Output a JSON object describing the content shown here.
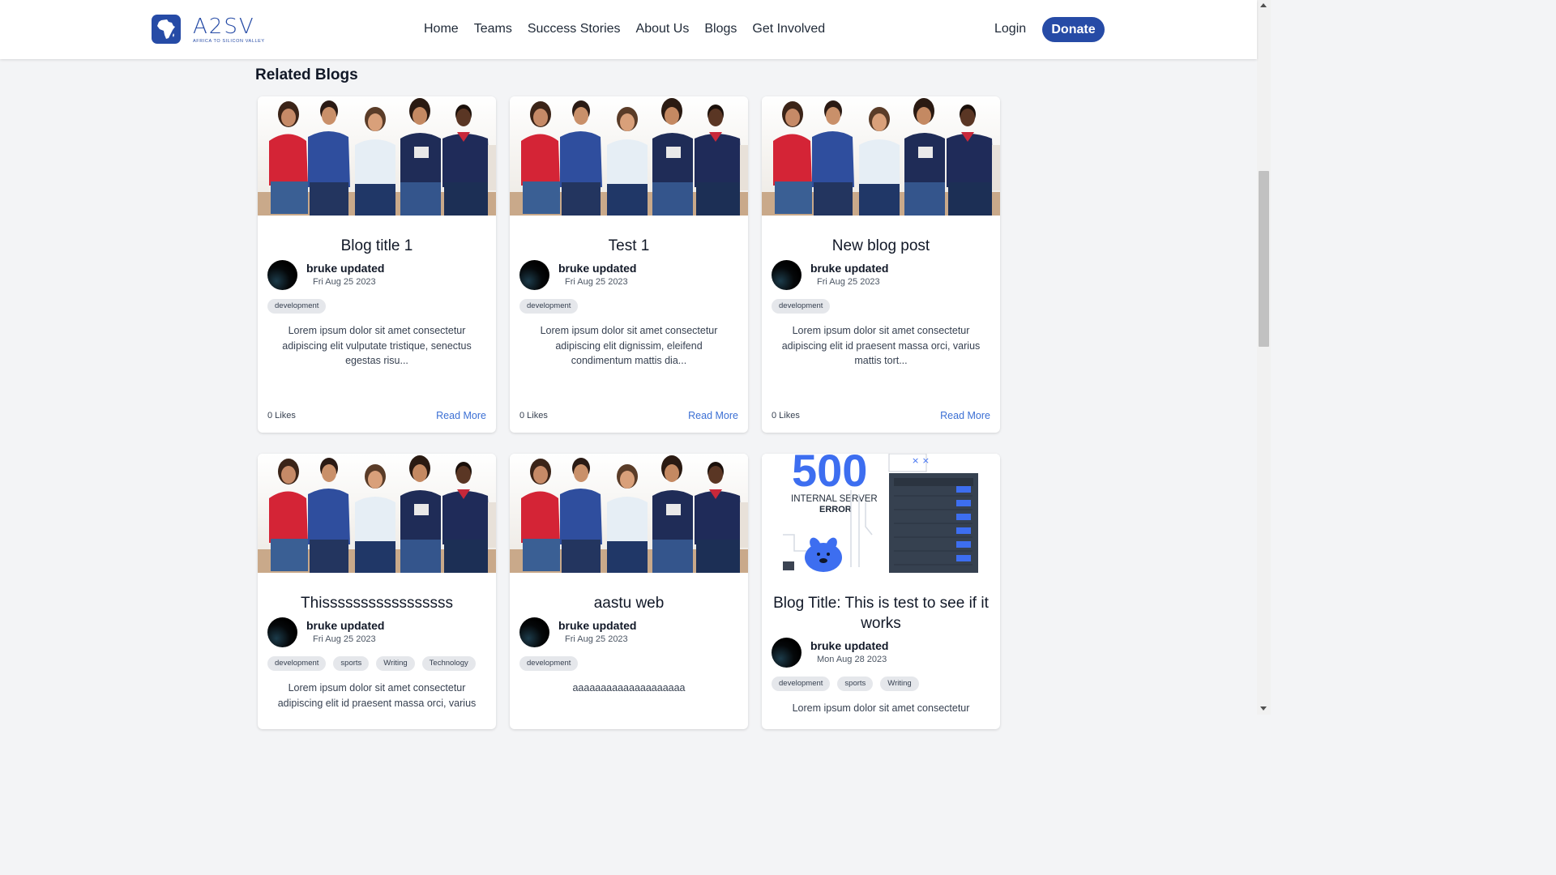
{
  "header": {
    "logo_text": "A2SV",
    "logo_subtitle": "AFRICA TO SILICON VALLEY",
    "nav": [
      "Home",
      "Teams",
      "Success Stories",
      "About Us",
      "Blogs",
      "Get Involved"
    ],
    "login": "Login",
    "donate": "Donate"
  },
  "section_title": "Related Blogs",
  "cards": [
    {
      "title": "Blog title 1",
      "author": "bruke updated",
      "date": "Fri Aug 25 2023",
      "tags": [
        "development"
      ],
      "excerpt": "Lorem ipsum dolor sit amet consectetur adipiscing elit vulputate tristique, senectus egestas risu...",
      "likes": "0 Likes",
      "read_more": "Read More",
      "image": "group-photo"
    },
    {
      "title": "Test 1",
      "author": "bruke updated",
      "date": "Fri Aug 25 2023",
      "tags": [
        "development"
      ],
      "excerpt": "Lorem ipsum dolor sit amet consectetur adipiscing elit dignissim, eleifend condimentum mattis dia...",
      "likes": "0 Likes",
      "read_more": "Read More",
      "image": "group-photo"
    },
    {
      "title": "New blog post",
      "author": "bruke updated",
      "date": "Fri Aug 25 2023",
      "tags": [
        "development"
      ],
      "excerpt": "Lorem ipsum dolor sit amet consectetur adipiscing elit id praesent massa orci, varius mattis tort...",
      "likes": "0 Likes",
      "read_more": "Read More",
      "image": "group-photo"
    },
    {
      "title": "Thisssssssssssssssss",
      "author": "bruke updated",
      "date": "Fri Aug 25 2023",
      "tags": [
        "development",
        "sports",
        "Writing",
        "Technology"
      ],
      "excerpt": "Lorem ipsum dolor sit amet consectetur adipiscing elit id praesent massa orci, varius",
      "image": "group-photo"
    },
    {
      "title": "aastu web",
      "author": "bruke updated",
      "date": "Fri Aug 25 2023",
      "tags": [
        "development"
      ],
      "excerpt": "aaaaaaaaaaaaaaaaaaaa",
      "image": "group-photo"
    },
    {
      "title": "Blog Title: This is test to see if it works",
      "author": "bruke updated",
      "date": "Mon Aug 28 2023",
      "tags": [
        "development",
        "sports",
        "Writing"
      ],
      "excerpt": "Lorem ipsum dolor sit amet consectetur",
      "image": "error-illustration",
      "image_text": {
        "code": "500",
        "line1": "INTERNAL SERVER",
        "line2": "ERROR"
      }
    }
  ],
  "colors": {
    "brand": "#264ba6",
    "link": "#3b6fd4",
    "background": "#f3f4f6"
  }
}
